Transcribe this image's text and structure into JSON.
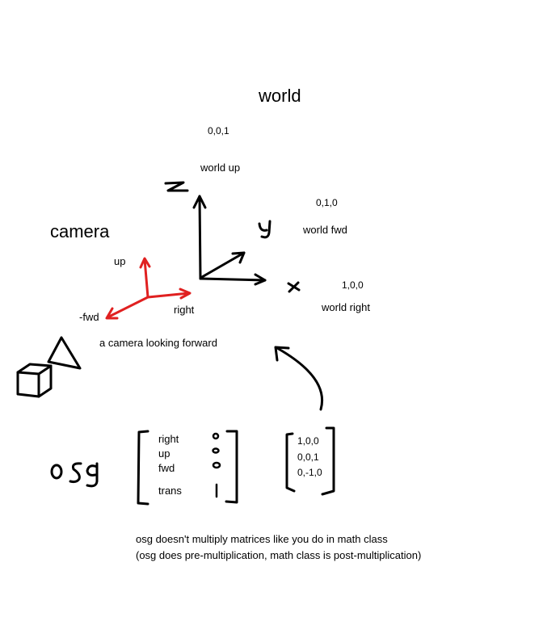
{
  "world": {
    "title": "world",
    "up_vec": "0,0,1",
    "up_label": "world up",
    "fwd_vec": "0,1,0",
    "fwd_label": "world fwd",
    "right_vec": "1,0,0",
    "right_label": "world right",
    "z_letter": "z",
    "y_letter": "y",
    "x_letter": "x"
  },
  "camera": {
    "title": "camera",
    "up_label": "up",
    "fwd_label": "-fwd",
    "right_label": "right",
    "caption": "a camera looking forward"
  },
  "osg": {
    "label": "osg",
    "rows": [
      "right",
      "up",
      "fwd",
      "trans"
    ],
    "values": [
      "1,0,0",
      "0,0,1",
      "0,-1,0"
    ],
    "note_line1": "osg doesn't multiply matrices like you do in math class",
    "note_line2": "(osg does pre-multiplication, math class is post-multiplication)"
  },
  "colors": {
    "ink": "#000000",
    "camera_axes": "#e02020"
  }
}
